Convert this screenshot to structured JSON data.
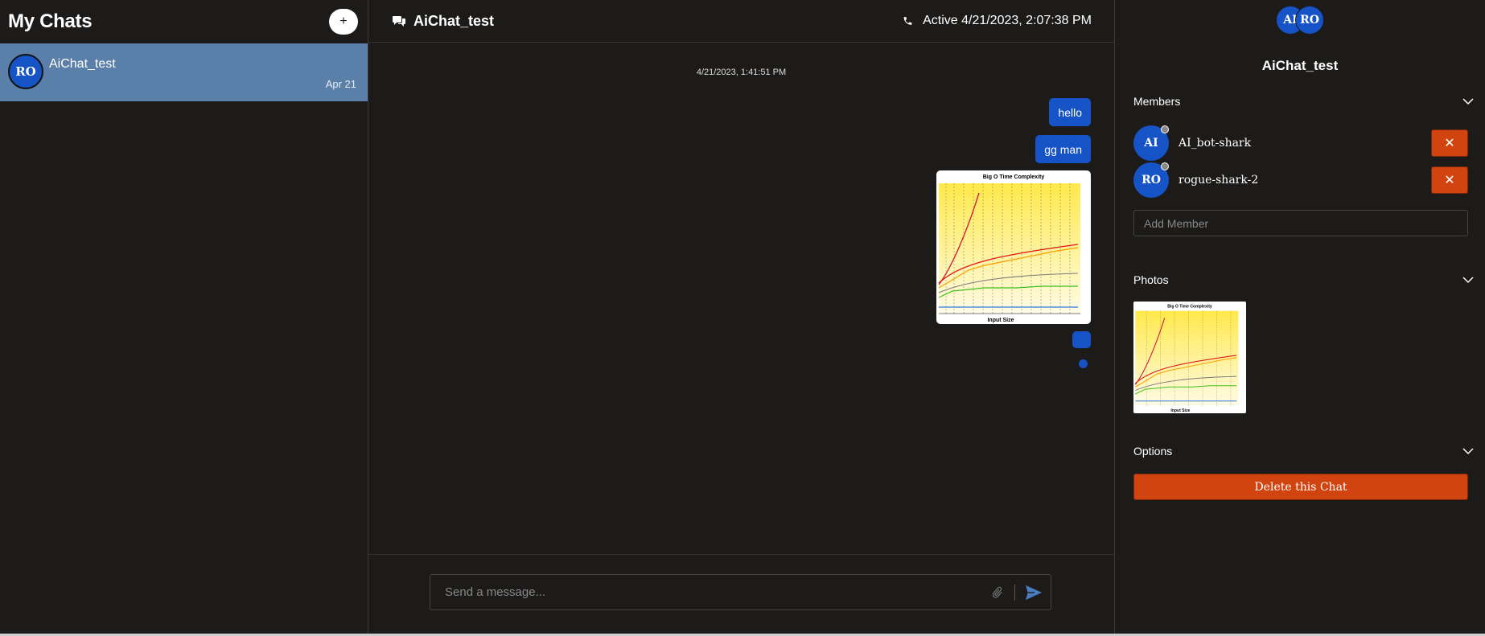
{
  "sidebar": {
    "title": "My Chats",
    "new_chat_label": "+",
    "chats": [
      {
        "avatar": "RO",
        "name": "AiChat_test",
        "date": "Apr 21"
      }
    ]
  },
  "chat": {
    "title": "AiChat_test",
    "status": "Active 4/21/2023, 2:07:38 PM",
    "timestamp": "4/21/2023, 1:41:51 PM",
    "messages": [
      {
        "type": "text",
        "text": "hello"
      },
      {
        "type": "text",
        "text": "gg man"
      },
      {
        "type": "image",
        "chart": {
          "title": "Big O Time Complexity",
          "xlabel": "Input Size"
        }
      },
      {
        "type": "text",
        "text": ""
      }
    ],
    "composer": {
      "placeholder": "Send a message..."
    }
  },
  "details": {
    "avatars": [
      "AI",
      "RO"
    ],
    "title": "AiChat_test",
    "members_label": "Members",
    "members": [
      {
        "avatar": "AI",
        "name": "AI_bot-shark",
        "remove": "✕"
      },
      {
        "avatar": "RO",
        "name": "rogue-shark-2",
        "remove": "✕"
      }
    ],
    "add_member_placeholder": "Add Member",
    "photos_label": "Photos",
    "options_label": "Options",
    "delete_label": "Delete this Chat"
  },
  "colors": {
    "accent_blue": "#1553c6",
    "danger": "#d1440f",
    "selected_chat": "#5a7fa8",
    "background": "#1c1b1a"
  },
  "icons": {
    "chat": "chat-bubbles-icon",
    "phone": "phone-icon",
    "attach": "paperclip-icon",
    "send": "send-icon",
    "chevron": "chevron-down-icon",
    "close": "close-icon"
  }
}
